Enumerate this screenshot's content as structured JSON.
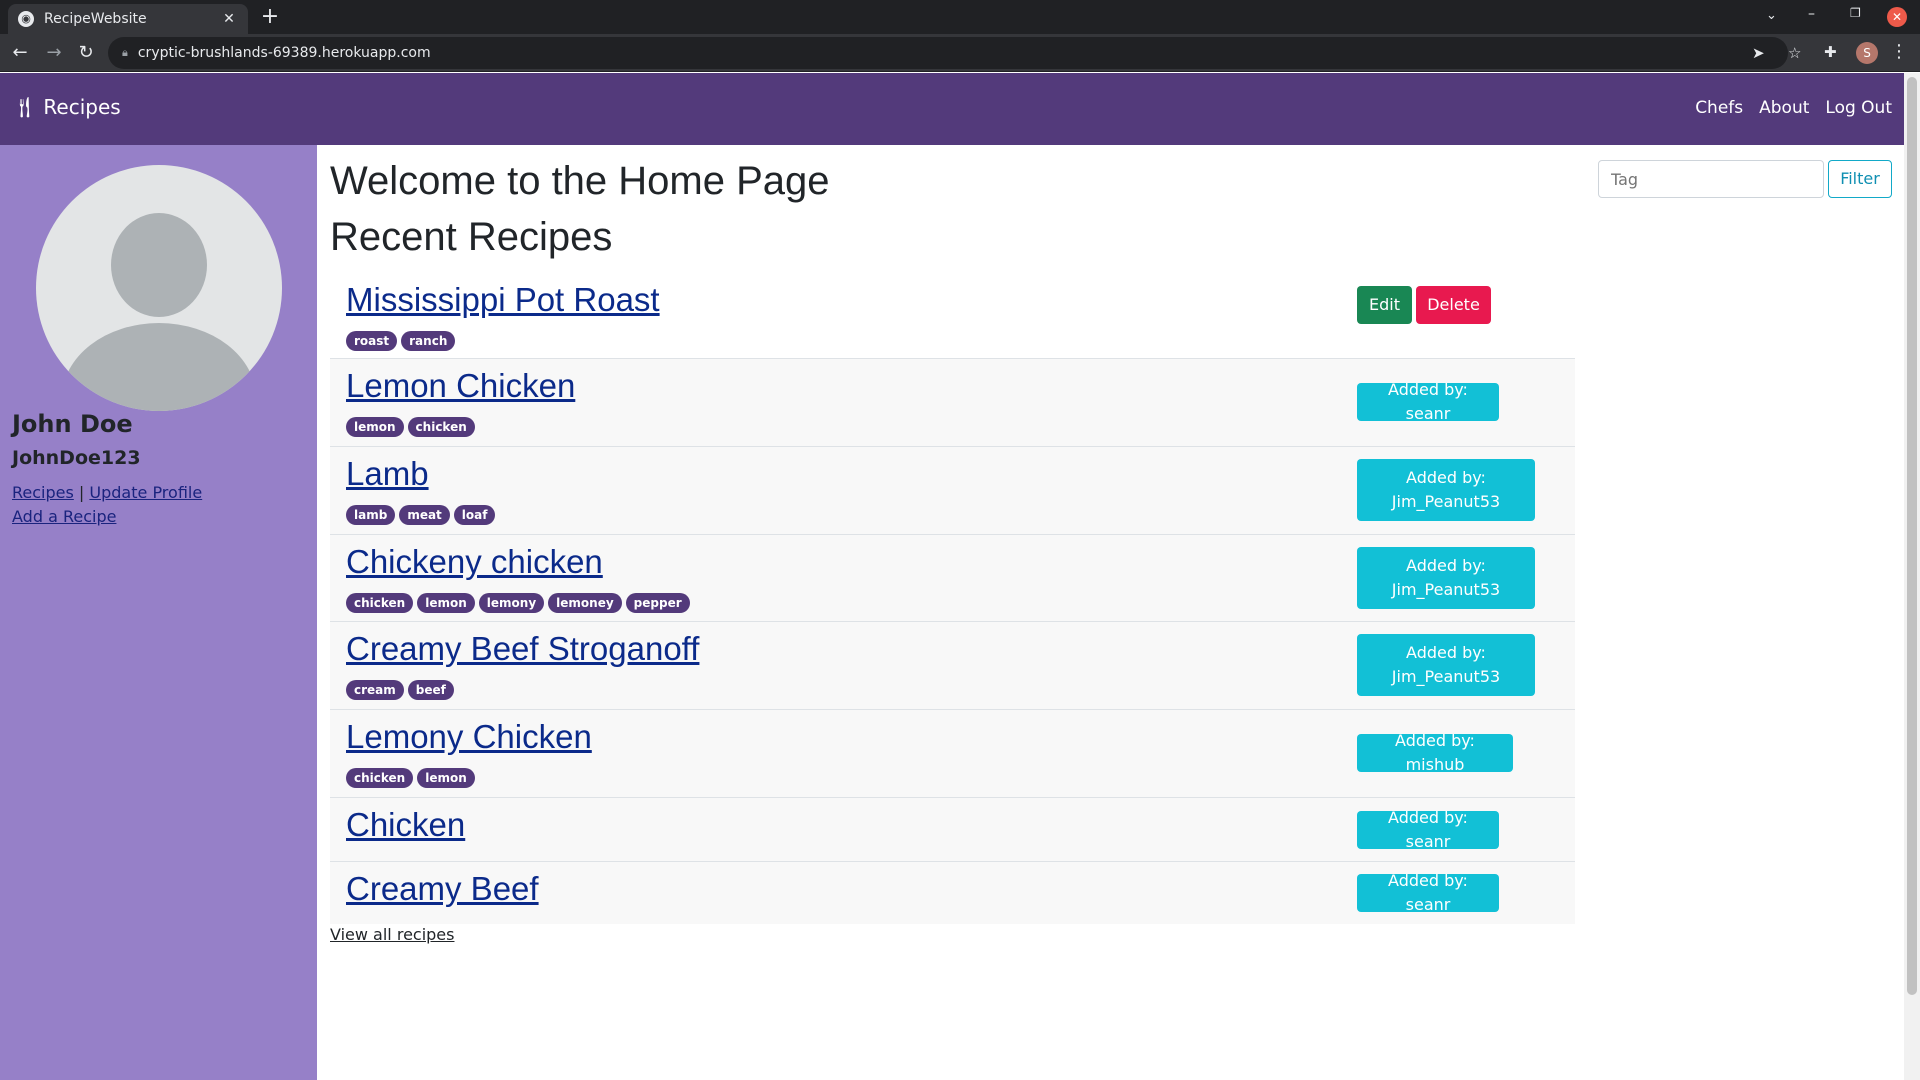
{
  "browser": {
    "tab_title": "RecipeWebsite",
    "url": "cryptic-brushlands-69389.herokuapp.com",
    "profile_initial": "S"
  },
  "navbar": {
    "brand": "Recipes",
    "links": [
      "Chefs",
      "About",
      "Log Out"
    ]
  },
  "sidebar": {
    "name": "John Doe",
    "username": "JohnDoe123",
    "link_recipes": "Recipes",
    "separator": "|",
    "link_update": "Update Profile",
    "link_add": "Add a Recipe"
  },
  "main": {
    "heading": "Welcome to the Home Page",
    "subheading": "Recent Recipes",
    "view_all": "View all recipes"
  },
  "filter": {
    "placeholder": "Tag",
    "button": "Filter"
  },
  "recipes": [
    {
      "title": "Mississippi Pot Roast",
      "tags": [
        "roast",
        "ranch"
      ],
      "edit": "Edit",
      "delete": "Delete"
    },
    {
      "title": "Lemon Chicken",
      "tags": [
        "lemon",
        "chicken"
      ],
      "added_by": "Added by: seanr"
    },
    {
      "title": "Lamb",
      "tags": [
        "lamb",
        "meat",
        "loaf"
      ],
      "added_by": "Added by:",
      "added_by_user": "Jim_Peanut53"
    },
    {
      "title": "Chickeny chicken",
      "tags": [
        "chicken",
        "lemon",
        "lemony",
        "lemoney",
        "pepper"
      ],
      "added_by": "Added by:",
      "added_by_user": "Jim_Peanut53"
    },
    {
      "title": "Creamy Beef Stroganoff",
      "tags": [
        "cream",
        "beef"
      ],
      "added_by": "Added by:",
      "added_by_user": "Jim_Peanut53"
    },
    {
      "title": "Lemony Chicken",
      "tags": [
        "chicken",
        "lemon"
      ],
      "added_by": "Added by: mishub"
    },
    {
      "title": "Chicken",
      "tags": [],
      "added_by": "Added by: seanr"
    },
    {
      "title": "Creamy Beef",
      "tags": [],
      "added_by": "Added by: seanr"
    }
  ]
}
